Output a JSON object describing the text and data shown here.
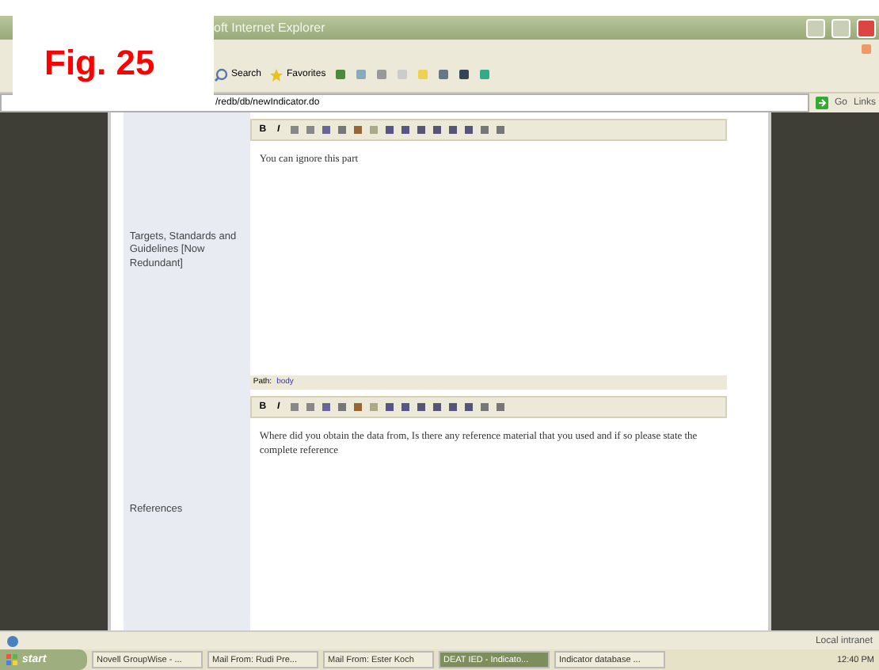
{
  "figure_label": "Fig. 25",
  "window": {
    "title": "oft Internet Explorer"
  },
  "toolbar": {
    "buttons": [
      {
        "label": "Search",
        "kind": "search"
      },
      {
        "label": "Favorites",
        "kind": "favorites"
      }
    ]
  },
  "address_bar": {
    "value": "/redb/db/newIndicator.do",
    "go": "Go",
    "links": "Links"
  },
  "form": {
    "rows": [
      {
        "label": "Targets, Standards and Guidelines [Now Redundant]",
        "text": "You can ignore this part",
        "path_label": "Path:",
        "path": "body",
        "toolbar": [
          "B",
          "I"
        ]
      },
      {
        "label": "References",
        "text": "Where did you obtain the data from, Is there any reference material that you used and if so please state the complete reference",
        "toolbar": [
          "B",
          "I"
        ]
      }
    ]
  },
  "status_bar": {
    "zone": "Local intranet"
  },
  "taskbar": {
    "start": "start",
    "tasks": [
      {
        "label": "Novell GroupWise - ...",
        "selected": false
      },
      {
        "label": "Mail From: Rudi Pre...",
        "selected": false
      },
      {
        "label": "Mail From: Ester Koch",
        "selected": false
      },
      {
        "label": "DEAT IED - Indicato...",
        "selected": true
      },
      {
        "label": "Indicator database ...",
        "selected": false
      }
    ],
    "clock": "12:40 PM"
  }
}
